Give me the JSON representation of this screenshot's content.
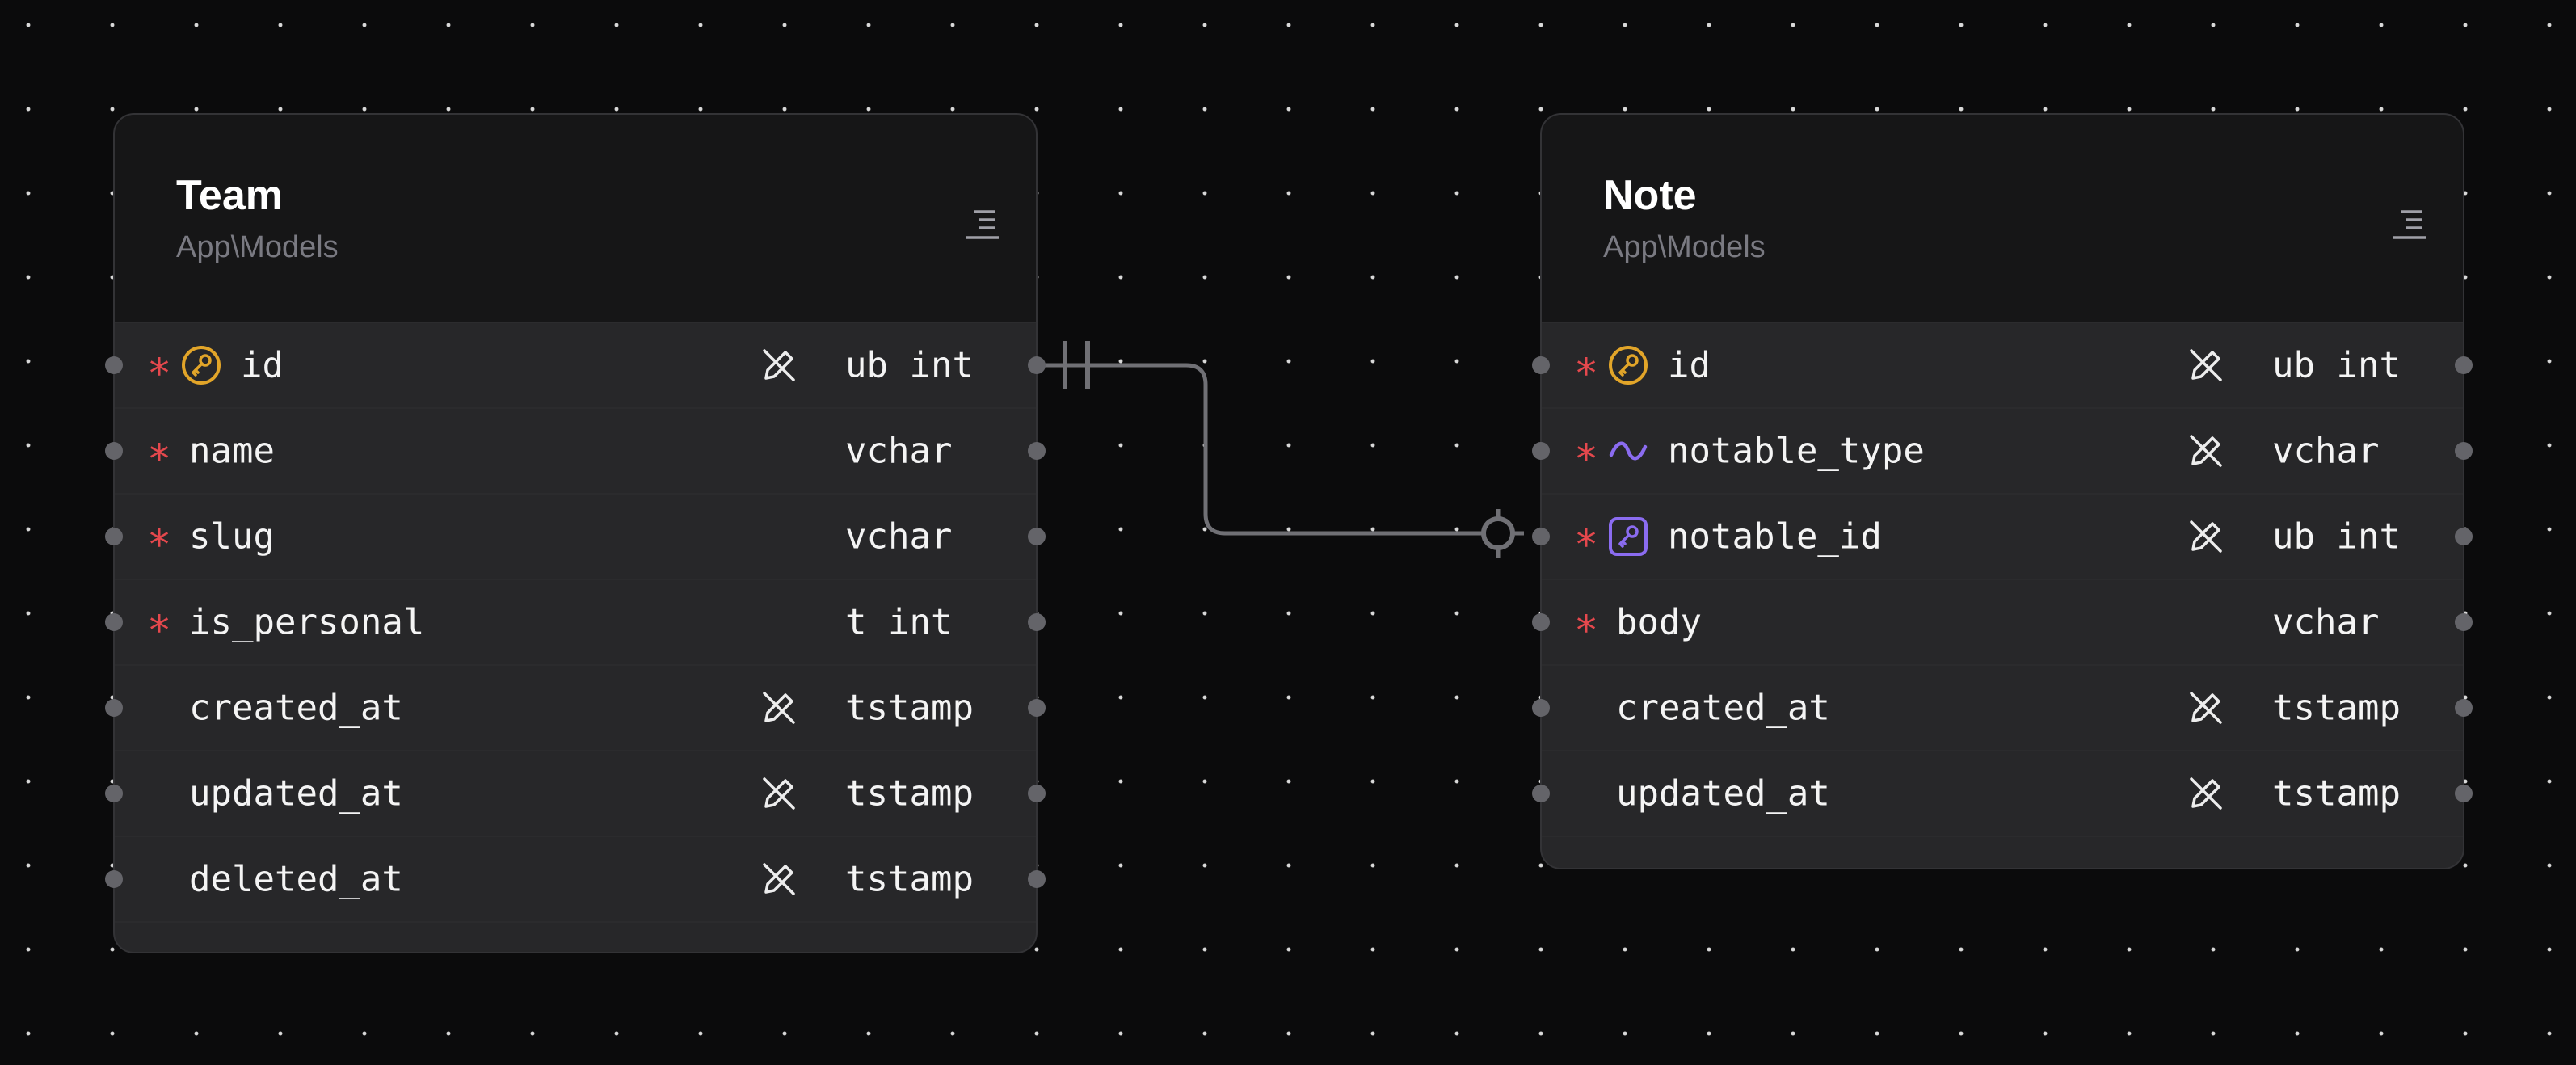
{
  "tables": [
    {
      "id": "team",
      "name": "Team",
      "namespace": "App\\Models",
      "columns": [
        {
          "name": "id",
          "type": "ub int",
          "required": true,
          "icon": "key-icon",
          "nullable_icon": true
        },
        {
          "name": "name",
          "type": "vchar",
          "required": true,
          "icon": "",
          "nullable_icon": false
        },
        {
          "name": "slug",
          "type": "vchar",
          "required": true,
          "icon": "",
          "nullable_icon": false
        },
        {
          "name": "is_personal",
          "type": "t int",
          "required": true,
          "icon": "",
          "nullable_icon": false
        },
        {
          "name": "created_at",
          "type": "tstamp",
          "required": false,
          "icon": "",
          "nullable_icon": true
        },
        {
          "name": "updated_at",
          "type": "tstamp",
          "required": false,
          "icon": "",
          "nullable_icon": true
        },
        {
          "name": "deleted_at",
          "type": "tstamp",
          "required": false,
          "icon": "",
          "nullable_icon": true
        }
      ]
    },
    {
      "id": "note",
      "name": "Note",
      "namespace": "App\\Models",
      "columns": [
        {
          "name": "id",
          "type": "ub int",
          "required": true,
          "icon": "key-icon",
          "nullable_icon": true
        },
        {
          "name": "notable_type",
          "type": "vchar",
          "required": true,
          "icon": "polymorphic-icon",
          "nullable_icon": true
        },
        {
          "name": "notable_id",
          "type": "ub int",
          "required": true,
          "icon": "foreign-key-icon",
          "nullable_icon": true
        },
        {
          "name": "body",
          "type": "vchar",
          "required": true,
          "icon": "",
          "nullable_icon": false
        },
        {
          "name": "created_at",
          "type": "tstamp",
          "required": false,
          "icon": "",
          "nullable_icon": true
        },
        {
          "name": "updated_at",
          "type": "tstamp",
          "required": false,
          "icon": "",
          "nullable_icon": true
        }
      ]
    }
  ],
  "relationship": {
    "from": "team.id",
    "to": "note.notable_id",
    "from_cardinality": "one-and-only-one",
    "to_cardinality": "zero-or-one"
  },
  "colors": {
    "required": "#e5484d",
    "key": "#e2a529",
    "polymorphic": "#8b6cf0",
    "connector": "#707075"
  },
  "icons": {
    "required": "∗",
    "nullable": "pencil-off-icon",
    "table_menu": "menu-icon"
  }
}
